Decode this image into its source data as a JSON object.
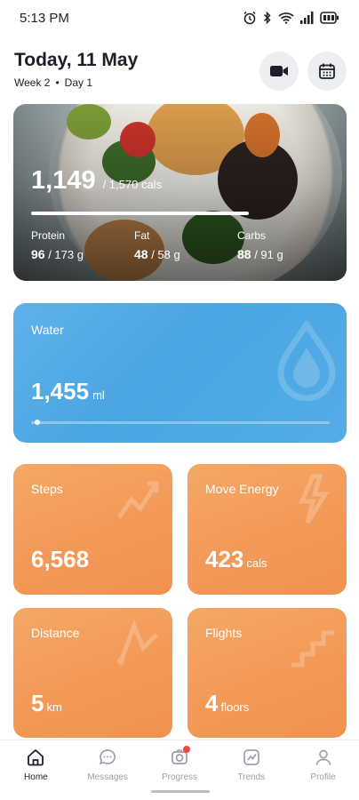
{
  "status_bar": {
    "time": "5:13 PM"
  },
  "header": {
    "title": "Today, 11 May",
    "week": "Week 2",
    "separator": "•",
    "day": "Day 1",
    "video_button_icon": "video-camera-icon",
    "calendar_button_icon": "calendar-icon"
  },
  "food": {
    "calories": "1,149",
    "calories_goal": "/ 1,570 cals",
    "calories_progress": 0.73,
    "macros": [
      {
        "label": "Protein",
        "value": "96",
        "goal": "/ 173 g"
      },
      {
        "label": "Fat",
        "value": "48",
        "goal": "/ 58 g"
      },
      {
        "label": "Carbs",
        "value": "88",
        "goal": "/ 91 g"
      }
    ]
  },
  "water": {
    "label": "Water",
    "value": "1,455",
    "unit": "ml",
    "progress": 0.02
  },
  "metrics": {
    "steps": {
      "label": "Steps",
      "value": "6,568",
      "unit": ""
    },
    "move": {
      "label": "Move Energy",
      "value": "423",
      "unit": "cals"
    },
    "distance": {
      "label": "Distance",
      "value": "5",
      "unit": "km"
    },
    "flights": {
      "label": "Flights",
      "value": "4",
      "unit": "floors"
    }
  },
  "nav": [
    {
      "label": "Home",
      "icon": "home-icon",
      "active": true
    },
    {
      "label": "Messages",
      "icon": "chat-icon",
      "active": false
    },
    {
      "label": "Progress",
      "icon": "camera-icon",
      "active": false,
      "badge": true
    },
    {
      "label": "Trends",
      "icon": "trend-chart-icon",
      "active": false
    },
    {
      "label": "Profile",
      "icon": "user-icon",
      "active": false
    }
  ],
  "colors": {
    "water_card": "#4aa5e2",
    "metric_card": "#f39a59",
    "badge": "#e94a3a"
  }
}
